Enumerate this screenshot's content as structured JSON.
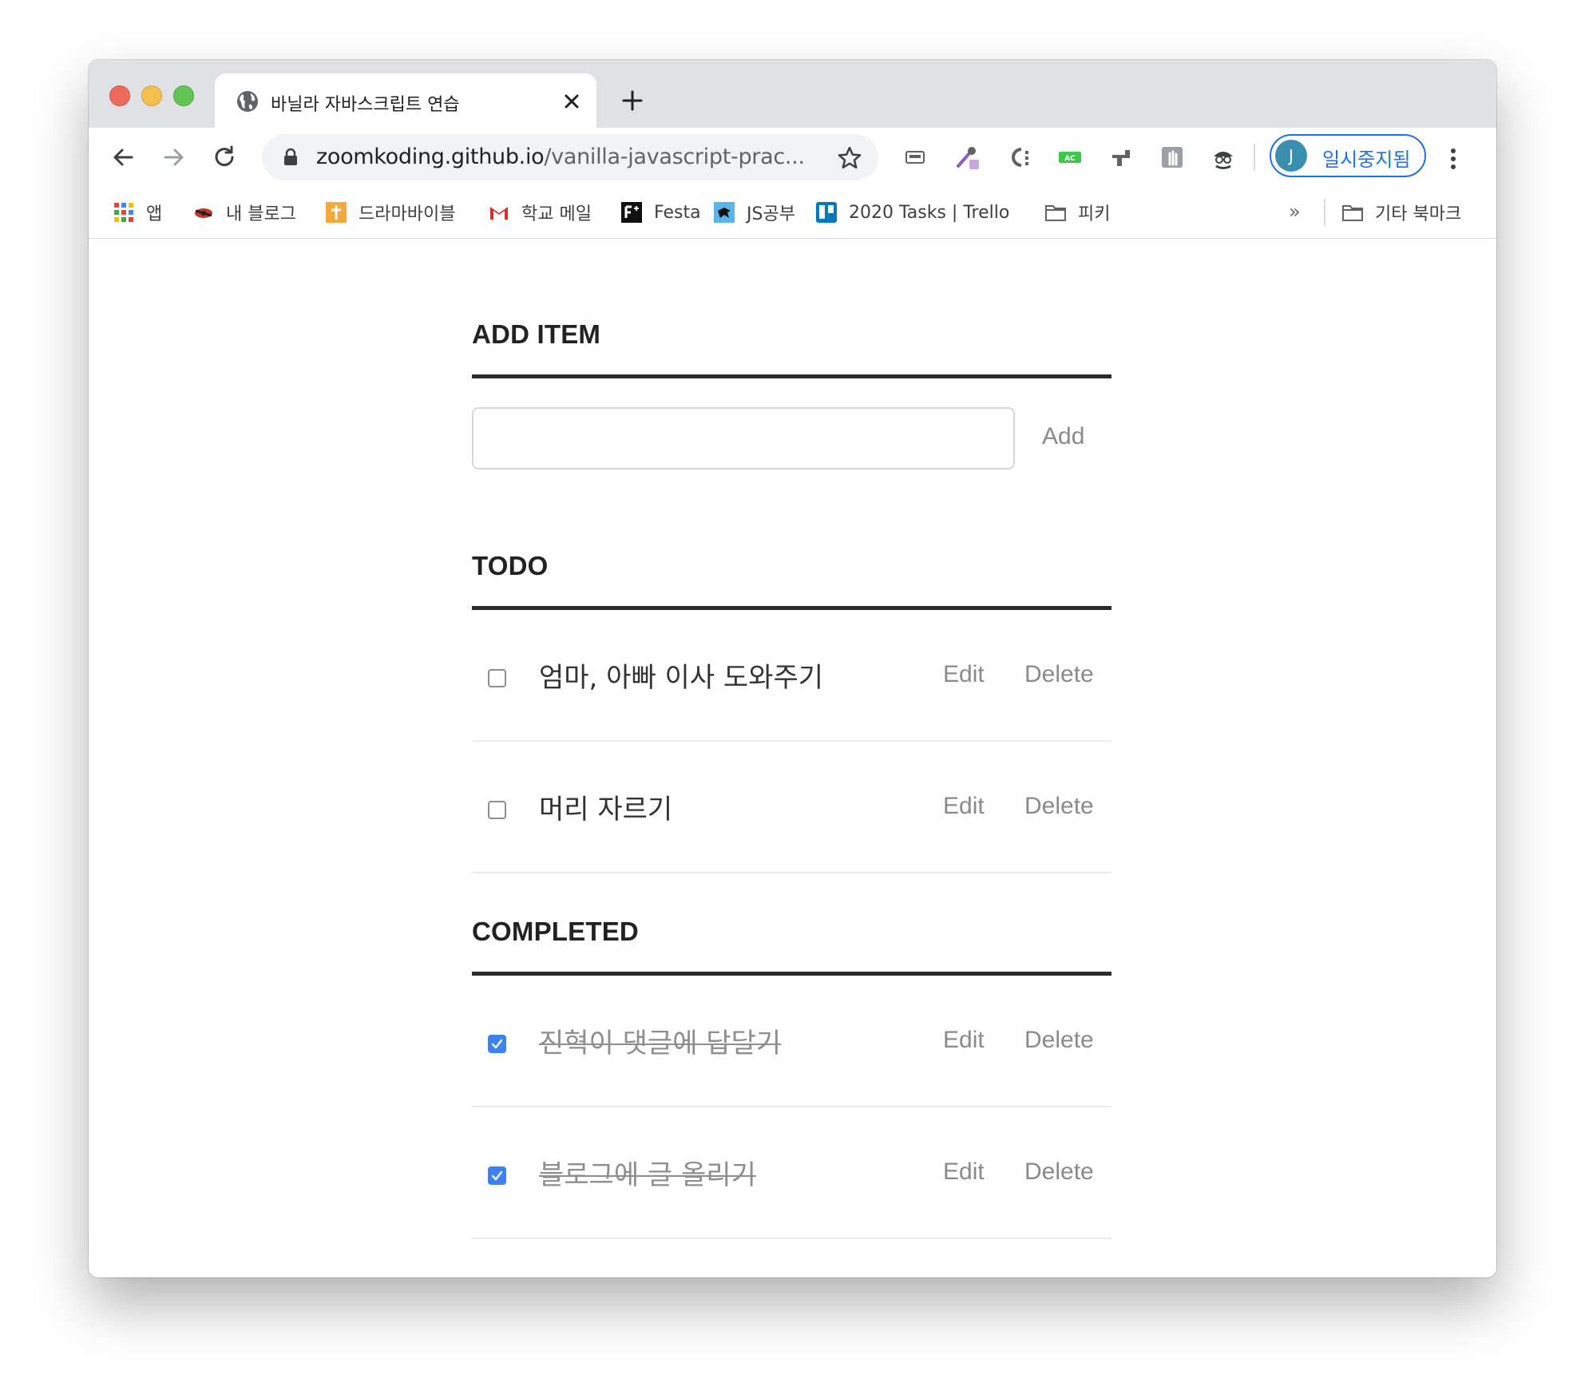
{
  "browser": {
    "tab_title": "바닐라 자바스크립트 연습",
    "url_host": "zoomkoding.github.io",
    "url_path": "/vanilla-javascript-prac...",
    "profile_initial": "J",
    "profile_status": "일시중지됨",
    "bookmarks_more": "»",
    "bookmarks": [
      {
        "label": "앱",
        "icon": "apps-grid-icon"
      },
      {
        "label": "내 블로그",
        "icon": "blog-icon"
      },
      {
        "label": "드라마바이블",
        "icon": "drama-bible-icon"
      },
      {
        "label": "학교 메일",
        "icon": "gmail-icon"
      },
      {
        "label": "Festa",
        "icon": "festa-icon"
      },
      {
        "label": "JS공부",
        "icon": "js-study-icon"
      },
      {
        "label": "2020 Tasks | Trello",
        "icon": "trello-icon"
      },
      {
        "label": "피키",
        "icon": "folder-icon"
      },
      {
        "label": "기타 북마크",
        "icon": "folder-icon"
      }
    ]
  },
  "page": {
    "add_section": {
      "title": "ADD ITEM",
      "input_value": "",
      "button_label": "Add"
    },
    "todo_section": {
      "title": "TODO",
      "items": [
        {
          "text": "엄마, 아빠 이사 도와주기",
          "checked": false,
          "edit_label": "Edit",
          "delete_label": "Delete"
        },
        {
          "text": "머리 자르기",
          "checked": false,
          "edit_label": "Edit",
          "delete_label": "Delete"
        }
      ]
    },
    "completed_section": {
      "title": "COMPLETED",
      "items": [
        {
          "text": "진혁이 댓글에 답달기",
          "checked": true,
          "edit_label": "Edit",
          "delete_label": "Delete"
        },
        {
          "text": "블로그에 글 올리기",
          "checked": true,
          "edit_label": "Edit",
          "delete_label": "Delete"
        }
      ]
    }
  },
  "colors": {
    "accent": "#1a73e8",
    "checkbox_checked": "#3b82f6",
    "rule": "#2b2b2b",
    "muted_text": "#8a8a8a"
  }
}
